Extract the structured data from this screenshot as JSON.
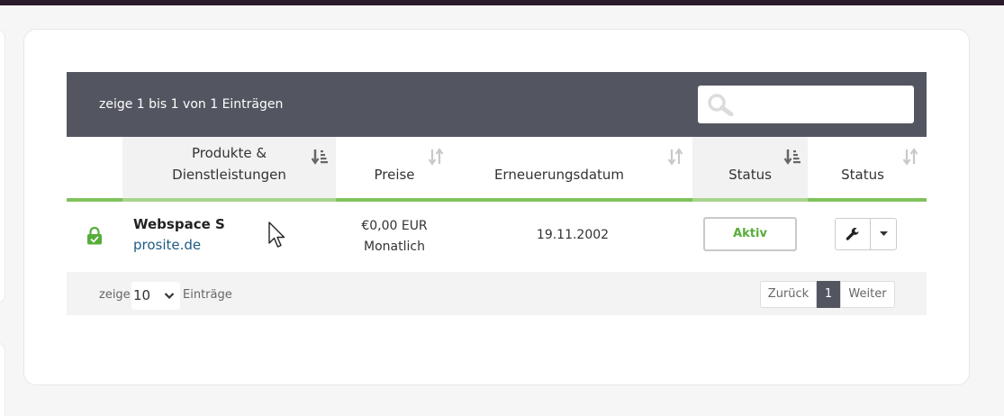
{
  "table": {
    "info": "zeige 1 bis 1 von 1 Einträgen",
    "search": {
      "placeholder": "",
      "value": ""
    },
    "columns": [
      {
        "label": "",
        "sortable": false
      },
      {
        "label": "Produkte & Dienstleistungen",
        "sort_icon": "sort-alpha-desc-icon",
        "sorted": true
      },
      {
        "label": "Preise",
        "sort_icon": "sort-icon",
        "sorted": false
      },
      {
        "label": "Erneuerungsdatum",
        "sort_icon": "sort-icon",
        "sorted": false
      },
      {
        "label": "Status",
        "sort_icon": "sort-alpha-desc-icon",
        "sorted": true
      },
      {
        "label": "Status",
        "sort_icon": "sort-icon",
        "sorted": false
      }
    ],
    "rows": [
      {
        "icon": "lock-icon",
        "product": "Webspace S",
        "domain": "prosite.de",
        "price": "€0,00 EUR",
        "cycle": "Monatlich",
        "renewal": "19.11.2002",
        "status": "Aktiv"
      }
    ],
    "footer": {
      "show_label": "zeige",
      "page_size": "10",
      "entries_label": "Einträge",
      "prev": "Zurück",
      "current_page": "1",
      "next": "Weiter"
    }
  },
  "colors": {
    "header_bg": "#535660",
    "accent_green": "#7fc25b",
    "status_green": "#57ad3a",
    "link_blue": "#1e5b86"
  }
}
